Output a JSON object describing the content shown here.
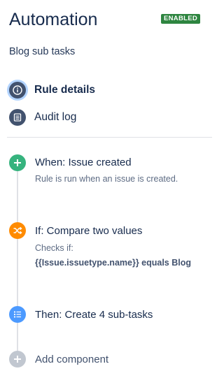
{
  "header": {
    "title": "Automation",
    "status_badge": "ENABLED",
    "rule_name": "Blog sub tasks"
  },
  "nav": {
    "items": [
      {
        "label": "Rule details",
        "icon": "info-icon",
        "active": true
      },
      {
        "label": "Audit log",
        "icon": "list-icon",
        "active": false
      }
    ]
  },
  "steps": {
    "trigger": {
      "title": "When: Issue created",
      "description": "Rule is run when an issue is created.",
      "icon": "plus-icon",
      "color": "#36b37e"
    },
    "condition": {
      "title": "If: Compare two values",
      "description": "Checks if:",
      "detail": "{{Issue.issuetype.name}} equals Blog",
      "icon": "shuffle-icon",
      "color": "#ff8b00"
    },
    "action": {
      "title": "Then: Create 4 sub-tasks",
      "icon": "subtasks-icon",
      "color": "#4c9aff"
    },
    "add": {
      "label": "Add component",
      "icon": "plus-icon",
      "color": "#c1c7d0"
    }
  }
}
